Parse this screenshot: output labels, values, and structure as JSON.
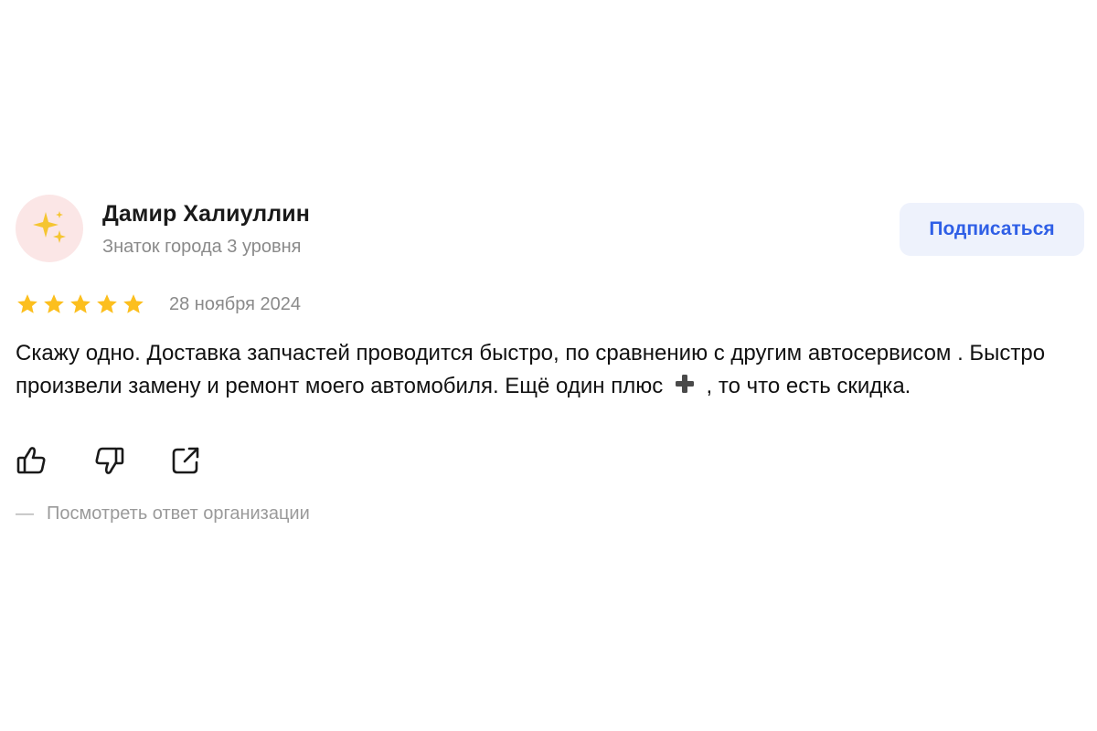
{
  "author": {
    "name": "Дамир Халиуллин",
    "level": "Знаток города 3 уровня",
    "avatar_icon": "sparkles-icon"
  },
  "subscribe_label": "Подписаться",
  "rating": {
    "stars": 5,
    "max": 5,
    "star_color": "#fcbf1e"
  },
  "date": "28 ноября 2024",
  "review": {
    "text_part1": "Скажу одно. Доставка запчастей проводится быстро, по сравнению с другим автосервисом . Быстро произвели замену и ремонт моего автомобиля. Ещё один плюс",
    "plus_icon": "heavy-plus-icon",
    "text_part2": ", то что есть скидка."
  },
  "actions": {
    "like_icon": "thumbs-up-icon",
    "dislike_icon": "thumbs-down-icon",
    "share_icon": "share-icon"
  },
  "org_reply": {
    "dash": "—",
    "label": "Посмотреть ответ организации"
  },
  "colors": {
    "accent": "#2f5fe6",
    "button_bg": "#eef2fc",
    "avatar_bg": "#fbe6e6",
    "muted": "#8a8a8a"
  }
}
